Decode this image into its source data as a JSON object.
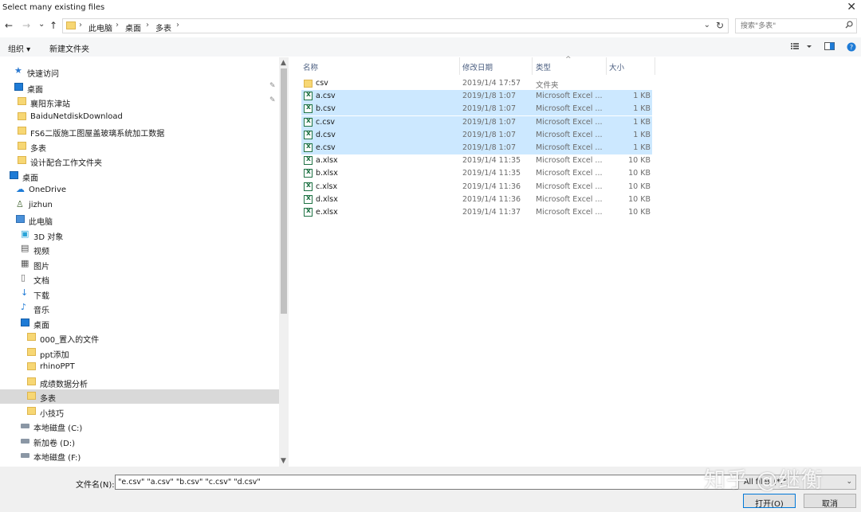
{
  "window": {
    "title": "Select many existing files",
    "close_glyph": "✕"
  },
  "nav_buttons": {
    "back": "←",
    "forward": "→",
    "recent": "⌄",
    "up": "↑"
  },
  "address": {
    "crumbs": [
      "此电脑",
      "桌面",
      "多表"
    ],
    "separator": "›",
    "dropdown": "⌄",
    "refresh": "↻"
  },
  "search": {
    "placeholder": "搜索\"多表\"",
    "icon": "search-icon"
  },
  "toolbar": {
    "organize": "组织 ▾",
    "new_folder": "新建文件夹"
  },
  "nav_pane": {
    "items": [
      {
        "label": "快速访问",
        "icon": "star-icon"
      },
      {
        "label": "桌面",
        "icon": "desktop-icon",
        "pinned": true
      },
      {
        "label": "襄阳东津站",
        "icon": "folder-icon",
        "pinned": true
      },
      {
        "label": "BaiduNetdiskDownload",
        "icon": "folder-icon"
      },
      {
        "label": "FS6二版施工图屋盖玻璃系统加工数据",
        "icon": "folder-icon"
      },
      {
        "label": "多表",
        "icon": "folder-icon"
      },
      {
        "label": "设计配合工作文件夹",
        "icon": "folder-icon"
      },
      {
        "label": "桌面",
        "icon": "desktop-icon"
      },
      {
        "label": "OneDrive",
        "icon": "cloud-icon"
      },
      {
        "label": "jizhun",
        "icon": "user-icon"
      },
      {
        "label": "此电脑",
        "icon": "computer-icon"
      },
      {
        "label": "3D 对象",
        "icon": "cube-icon"
      },
      {
        "label": "视频",
        "icon": "video-icon"
      },
      {
        "label": "图片",
        "icon": "picture-icon"
      },
      {
        "label": "文档",
        "icon": "document-icon"
      },
      {
        "label": "下载",
        "icon": "download-icon"
      },
      {
        "label": "音乐",
        "icon": "music-icon"
      },
      {
        "label": "桌面",
        "icon": "desktop-icon"
      },
      {
        "label": "000_置入的文件",
        "icon": "folder-icon"
      },
      {
        "label": "ppt添加",
        "icon": "folder-icon"
      },
      {
        "label": "rhinoPPT",
        "icon": "folder-icon"
      },
      {
        "label": "成绩数据分析",
        "icon": "folder-icon"
      },
      {
        "label": "多表",
        "icon": "folder-icon",
        "selected": true
      },
      {
        "label": "小技巧",
        "icon": "folder-icon"
      },
      {
        "label": "本地磁盘 (C:)",
        "icon": "drive-icon"
      },
      {
        "label": "新加卷 (D:)",
        "icon": "drive-icon"
      },
      {
        "label": "本地磁盘 (F:)",
        "icon": "drive-icon"
      }
    ]
  },
  "columns": {
    "name": "名称",
    "date": "修改日期",
    "type": "类型",
    "size": "大小"
  },
  "files": [
    {
      "name": "csv",
      "date": "2019/1/4 17:57",
      "type": "文件夹",
      "size": "",
      "kind": "folder",
      "selected": false
    },
    {
      "name": "a.csv",
      "date": "2019/1/8 1:07",
      "type": "Microsoft Excel ...",
      "size": "1 KB",
      "kind": "excel",
      "selected": true
    },
    {
      "name": "b.csv",
      "date": "2019/1/8 1:07",
      "type": "Microsoft Excel ...",
      "size": "1 KB",
      "kind": "excel",
      "selected": true
    },
    {
      "name": "c.csv",
      "date": "2019/1/8 1:07",
      "type": "Microsoft Excel ...",
      "size": "1 KB",
      "kind": "excel",
      "selected": true
    },
    {
      "name": "d.csv",
      "date": "2019/1/8 1:07",
      "type": "Microsoft Excel ...",
      "size": "1 KB",
      "kind": "excel",
      "selected": true
    },
    {
      "name": "e.csv",
      "date": "2019/1/8 1:07",
      "type": "Microsoft Excel ...",
      "size": "1 KB",
      "kind": "excel",
      "selected": true
    },
    {
      "name": "a.xlsx",
      "date": "2019/1/4 11:35",
      "type": "Microsoft Excel ...",
      "size": "10 KB",
      "kind": "excel",
      "selected": false
    },
    {
      "name": "b.xlsx",
      "date": "2019/1/4 11:35",
      "type": "Microsoft Excel ...",
      "size": "10 KB",
      "kind": "excel",
      "selected": false
    },
    {
      "name": "c.xlsx",
      "date": "2019/1/4 11:36",
      "type": "Microsoft Excel ...",
      "size": "10 KB",
      "kind": "excel",
      "selected": false
    },
    {
      "name": "d.xlsx",
      "date": "2019/1/4 11:36",
      "type": "Microsoft Excel ...",
      "size": "10 KB",
      "kind": "excel",
      "selected": false
    },
    {
      "name": "e.xlsx",
      "date": "2019/1/4 11:37",
      "type": "Microsoft Excel ...",
      "size": "10 KB",
      "kind": "excel",
      "selected": false
    }
  ],
  "bottom": {
    "filename_label": "文件名(N):",
    "filename_value": "\"e.csv\" \"a.csv\" \"b.csv\" \"c.csv\" \"d.csv\"",
    "filetype_value": "All files (*.*)",
    "open_label": "打开(O)",
    "cancel_label": "取消"
  },
  "watermark": "知乎 @继衡",
  "colors": {
    "selection": "#cce8ff",
    "nav_selected": "#d9d9d9",
    "primary_border": "#0078d7"
  }
}
